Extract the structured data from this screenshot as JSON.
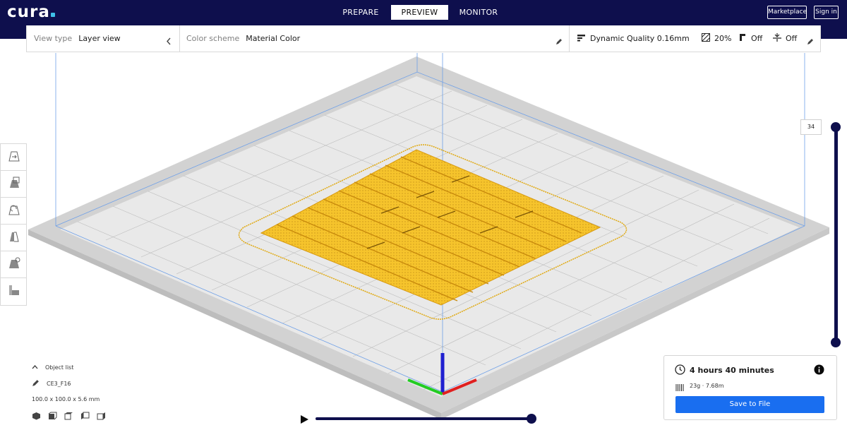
{
  "app": {
    "logo": "cura"
  },
  "stages": [
    {
      "label": "PREPARE",
      "active": false
    },
    {
      "label": "PREVIEW",
      "active": true
    },
    {
      "label": "MONITOR",
      "active": false
    }
  ],
  "top_buttons": {
    "marketplace": "Marketplace",
    "signin": "Sign in"
  },
  "header": {
    "view_type_label": "View type",
    "view_type_value": "Layer view",
    "color_scheme_label": "Color scheme",
    "color_scheme_value": "Material Color",
    "profile": "Dynamic Quality 0.16mm",
    "infill": "20%",
    "support": "Off",
    "adhesion": "Off"
  },
  "tools": [
    "move-icon",
    "scale-icon",
    "rotate-icon",
    "mirror-icon",
    "per-model-settings-icon",
    "support-blocker-icon"
  ],
  "layer_slider": {
    "current_layer": "34"
  },
  "object_list": {
    "toggle_label": "Object list",
    "object_name": "CE3_F16",
    "dimensions": "100.0 x 100.0 x 5.6 mm"
  },
  "print_panel": {
    "time": "4 hours 40 minutes",
    "material": "23g · 7.68m",
    "save_label": "Save to File"
  },
  "colors": {
    "brand_dark": "#0e0f4d",
    "accent_blue": "#196ef0",
    "material_yellow": "#f5c731",
    "build_plate": "#dcdcdc"
  }
}
